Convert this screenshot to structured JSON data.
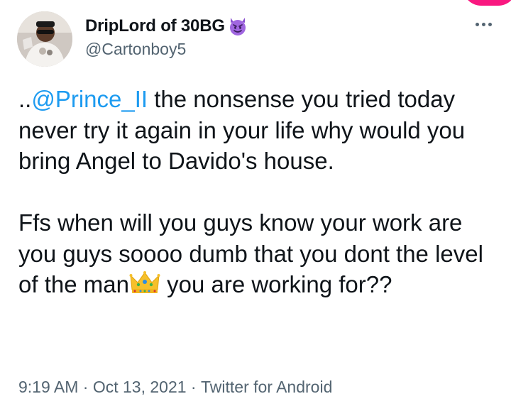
{
  "colors": {
    "accent": "#1d9bf0",
    "secondary_text": "#536471",
    "primary_text": "#0f1419",
    "corner_pink": "#f91880"
  },
  "author": {
    "display_name": "DripLord of 30BG",
    "name_emoji": "smiling-devil-icon",
    "handle": "@Cartonboy5",
    "avatar": "avatar"
  },
  "more_menu": {
    "icon": "more-horizontal-icon"
  },
  "tweet": {
    "prefix": "..",
    "mention": "@Prince_II",
    "line1_rest": " the nonsense you tried today never try it again in your life why would you bring Angel to Davido's house.",
    "para2_before_emoji": "Ffs when will you guys know your work are you guys soooo dumb that you dont the level of the man",
    "emoji": "crown-icon",
    "para2_after_emoji": " you are working for??"
  },
  "meta": {
    "time": "9:19 AM",
    "sep1": " · ",
    "date": "Oct 13, 2021",
    "sep2": " · ",
    "source": "Twitter for Android"
  }
}
